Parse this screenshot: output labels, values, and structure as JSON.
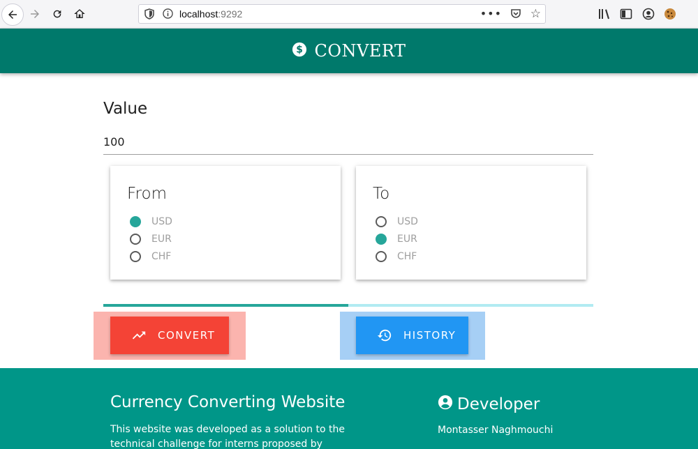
{
  "browser": {
    "url_host": "localhost",
    "url_port": ":9292",
    "icons": [
      "back-icon",
      "forward-icon",
      "reload-icon",
      "home-icon",
      "shield-icon",
      "info-icon",
      "more-icon",
      "pocket-icon",
      "bookmark-star-icon",
      "library-icon",
      "sidebar-icon",
      "account-icon",
      "cookie-extension-icon"
    ]
  },
  "header": {
    "title": "CONVERT",
    "icon": "dollar-circle-icon",
    "color": "#00796b"
  },
  "form": {
    "value_label": "Value",
    "value": "100",
    "from": {
      "title": "From",
      "options": [
        "USD",
        "EUR",
        "CHF"
      ],
      "selected": "USD"
    },
    "to": {
      "title": "To",
      "options": [
        "USD",
        "EUR",
        "CHF"
      ],
      "selected": "EUR"
    },
    "accent_color": "#26a69a"
  },
  "progress": {
    "fraction": 0.5
  },
  "actions": {
    "convert_label": "CONVERT",
    "convert_icon": "trending-up-icon",
    "convert_color": "#f44336",
    "history_label": "HISTORY",
    "history_icon": "history-icon",
    "history_color": "#2196f3"
  },
  "footer": {
    "title": "Currency Converting Website",
    "description": "This website was developed as a solution to the technical challenge for interns proposed by KLARX.",
    "developer_heading": "Developer",
    "developer_icon": "account-circle-icon",
    "developer_name": "Montasser Naghmouchi",
    "color": "#009688"
  }
}
